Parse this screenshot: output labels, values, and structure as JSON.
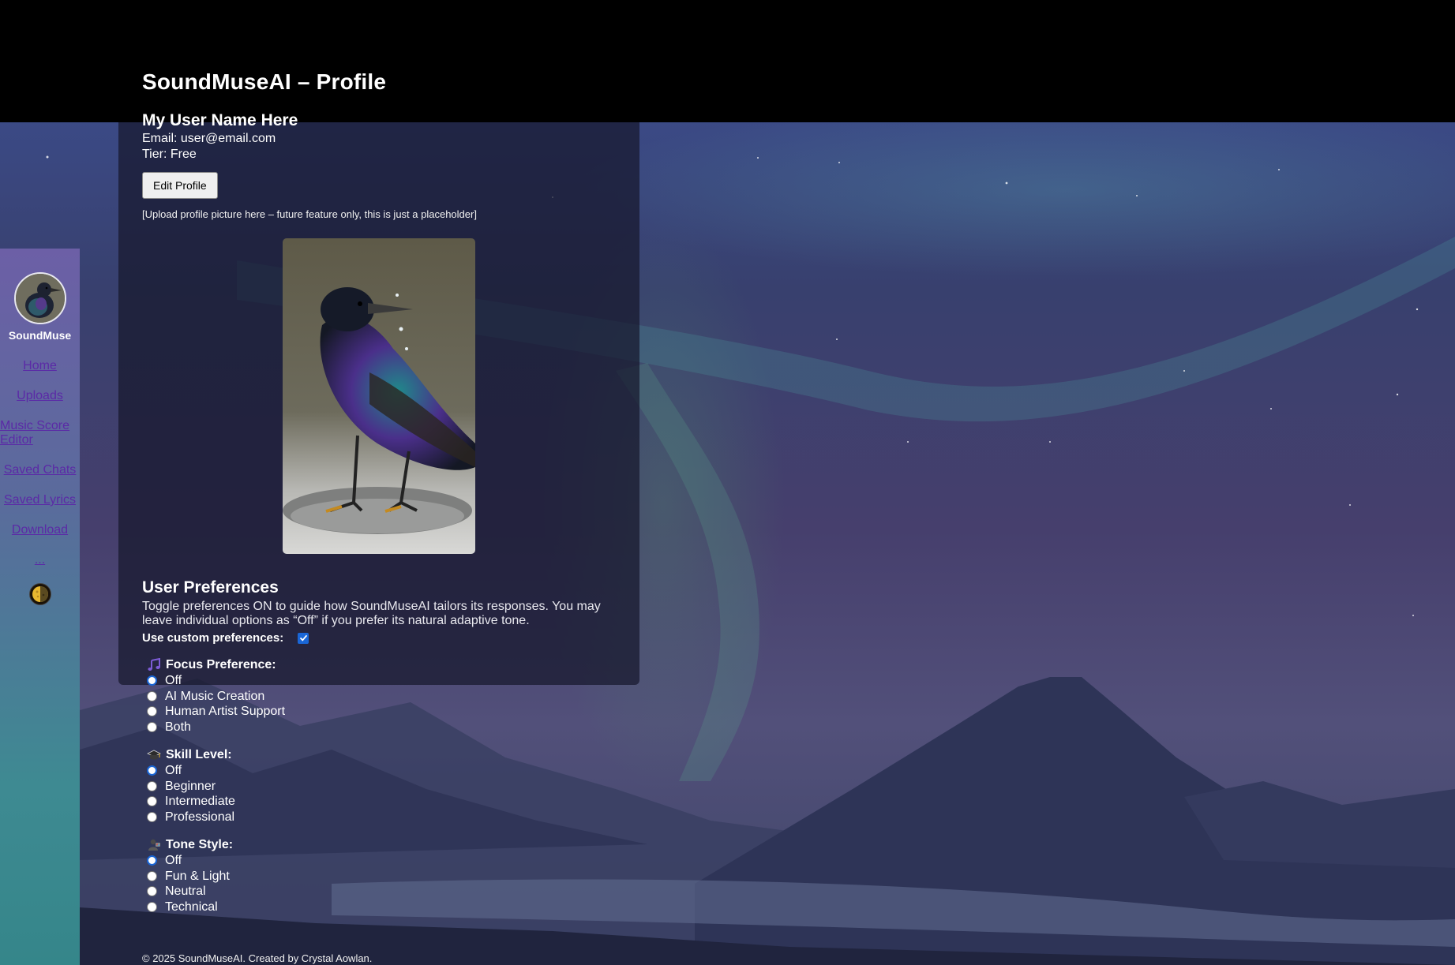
{
  "header": {
    "title": "SoundMuseAI – Profile"
  },
  "sidebar": {
    "brand": "SoundMuse",
    "links": [
      {
        "label": "Home"
      },
      {
        "label": "Uploads"
      },
      {
        "label": "Music Score Editor"
      },
      {
        "label": "Saved Chats"
      },
      {
        "label": "Saved Lyrics"
      },
      {
        "label": "Download"
      },
      {
        "label": "..."
      }
    ],
    "theme_toggle_icon": "half-moon-icon"
  },
  "profile": {
    "user_name": "My User Name Here",
    "email": "Email: user@email.com",
    "tier": "Tier: Free",
    "edit_button": "Edit Profile",
    "upload_note": "[Upload profile picture here – future feature only, this is just a placeholder]"
  },
  "preferences": {
    "title": "User Preferences",
    "description": "Toggle preferences ON to guide how SoundMuseAI tailors its responses. You may leave individual options as “Off” if you prefer its natural adaptive tone.",
    "custom_label": "Use custom preferences:",
    "custom_checked": true,
    "groups": [
      {
        "icon": "music-notes-icon",
        "title": "Focus Preference:",
        "selected": "Off",
        "options": [
          "Off",
          "AI Music Creation",
          "Human Artist Support",
          "Both"
        ]
      },
      {
        "icon": "graduation-cap-icon",
        "title": "Skill Level:",
        "selected": "Off",
        "options": [
          "Off",
          "Beginner",
          "Intermediate",
          "Professional"
        ]
      },
      {
        "icon": "artist-palette-icon",
        "title": "Tone Style:",
        "selected": "Off",
        "options": [
          "Off",
          "Fun & Light",
          "Neutral",
          "Technical"
        ]
      }
    ]
  },
  "footer": {
    "text": "© 2025 SoundMuseAI. Created by Crystal Aowlan."
  },
  "colors": {
    "link": "#5b2aa6",
    "accent": "#1a66d6",
    "header_bg": "#000000"
  }
}
